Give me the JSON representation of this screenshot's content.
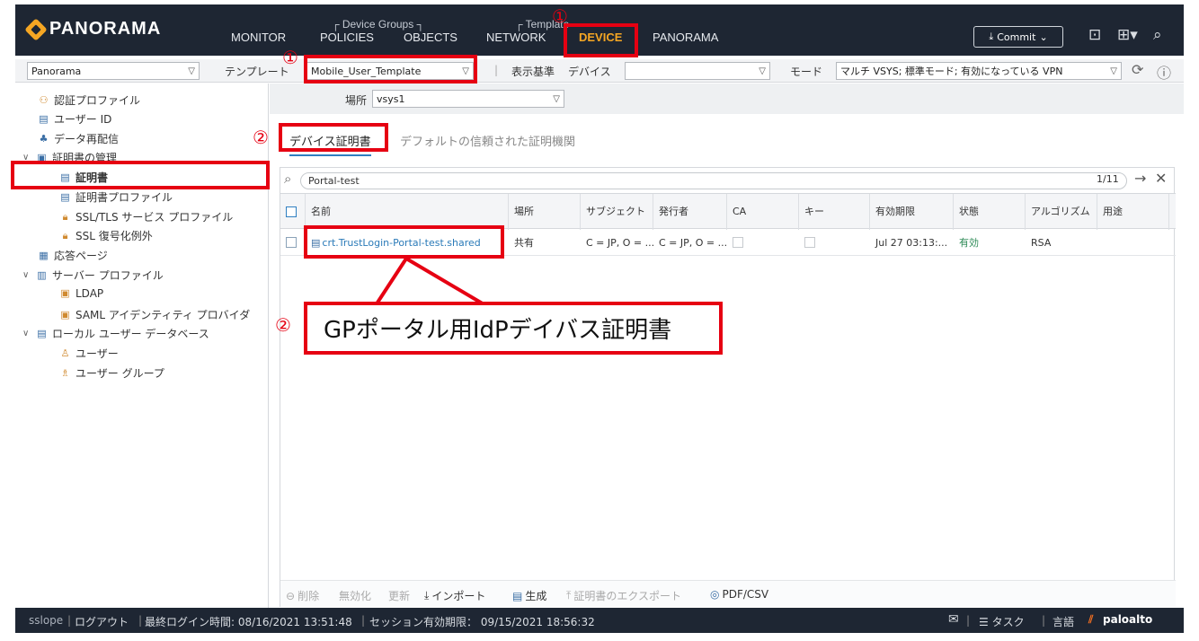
{
  "app": {
    "logo_text": "PANORAMA",
    "brand_color": "#f5a623"
  },
  "nav": {
    "groups": {
      "device_groups": "Device Groups",
      "template": "Template"
    },
    "items": [
      "MONITOR",
      "POLICIES",
      "OBJECTS",
      "NETWORK",
      "DEVICE",
      "PANORAMA"
    ],
    "active": "DEVICE",
    "commit_label": "Commit"
  },
  "context": {
    "scope_value": "Panorama",
    "template_label": "テンプレート",
    "template_value": "Mobile_User_Template",
    "view_label": "表示基準",
    "device_label": "デバイス",
    "device_value": "",
    "mode_label": "モード",
    "mode_value": "マルチ VSYS; 標準モード; 有効になっている VPN"
  },
  "sidebar": {
    "items": [
      {
        "label": "認証プロファイル",
        "icon": "auth-profile-icon"
      },
      {
        "label": "ユーザー ID",
        "icon": "user-id-icon"
      },
      {
        "label": "データ再配信",
        "icon": "data-redistribution-icon"
      },
      {
        "label": "証明書の管理",
        "icon": "cert-management-icon"
      },
      {
        "label": "証明書",
        "icon": "certificate-icon"
      },
      {
        "label": "証明書プロファイル",
        "icon": "cert-profile-icon"
      },
      {
        "label": "SSL/TLS サービス プロファイル",
        "icon": "lock-icon"
      },
      {
        "label": "SSL 復号化例外",
        "icon": "lock-icon"
      },
      {
        "label": "応答ページ",
        "icon": "response-page-icon"
      },
      {
        "label": "サーバー プロファイル",
        "icon": "server-profile-icon"
      },
      {
        "label": "LDAP",
        "icon": "ldap-icon"
      },
      {
        "label": "SAML アイデンティティ プロバイダ",
        "icon": "saml-icon"
      },
      {
        "label": "ローカル ユーザー データベース",
        "icon": "local-db-icon"
      },
      {
        "label": "ユーザー",
        "icon": "user-icon"
      },
      {
        "label": "ユーザー グループ",
        "icon": "user-group-icon"
      }
    ]
  },
  "main": {
    "location_label": "場所",
    "location_value": "vsys1",
    "tabs": [
      "デバイス証明書",
      "デフォルトの信頼された証明機関"
    ],
    "search_value": "Portal-test",
    "pagination": "1/11",
    "columns": [
      "名前",
      "場所",
      "サブジェクト",
      "発行者",
      "CA",
      "キー",
      "有効期限",
      "状態",
      "アルゴリズム",
      "用途"
    ],
    "rows": [
      {
        "name": "crt.TrustLogin-Portal-test.shared",
        "location": "共有",
        "subject": "C = JP, O = ...",
        "issuer": "C = JP, O = ...",
        "expires": "Jul 27 03:13:...",
        "status": "有効",
        "algorithm": "RSA",
        "usage": ""
      }
    ],
    "actions": [
      "削除",
      "無効化",
      "更新",
      "インポート",
      "生成",
      "証明書のエクスポート",
      "PDF/CSV"
    ]
  },
  "statusbar": {
    "user": "sslope",
    "logout": "ログアウト",
    "last_login_label": "最終ログイン時間:",
    "last_login_value": "08/16/2021 13:51:48",
    "session_label": "セッション有効期限：",
    "session_value": "09/15/2021 18:56:32",
    "tasks": "タスク",
    "language": "言語",
    "vendor": "paloalto"
  },
  "annotations": {
    "circle1": "①",
    "circle2": "②",
    "callout_text": "GPポータル用IdPデイバス証明書",
    "highlight_color": "#e60012"
  }
}
